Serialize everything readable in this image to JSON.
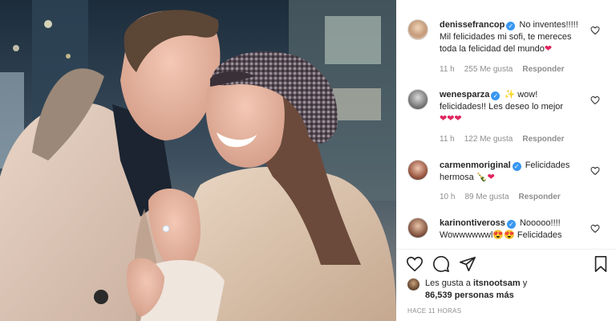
{
  "post": {
    "photo_alt": "",
    "comments": [
      {
        "username": "denissefrancop",
        "verified": true,
        "text_line1": "No inventes!!!!!",
        "text_line2": "Mil felicidades mi sofi, te mereces",
        "text_line3": "toda la felicidad del mundo",
        "emoji": "❤",
        "time": "11 h",
        "likes": "255 Me gusta",
        "reply": "Responder"
      },
      {
        "username": "wenesparza",
        "verified": true,
        "text_line1": "wow!",
        "text_line2": "felicidades!! Les deseo lo mejor",
        "emoji": "❤❤❤",
        "time": "11 h",
        "likes": "122 Me gusta",
        "reply": "Responder"
      },
      {
        "username": "carmenmoriginal",
        "verified": true,
        "text_line1": "Felicidades",
        "text_line2": "hermosa",
        "emoji": "❤",
        "time": "10 h",
        "likes": "89 Me gusta",
        "reply": "Responder"
      },
      {
        "username": "karinontiveross",
        "verified": true,
        "text_line1": "Nooooo!!!!",
        "text_line2": "Wowwwwwwl",
        "text_line2b": "Felicidades",
        "emoji": "😍😍"
      }
    ],
    "likes_summary": {
      "prefix": "Les gusta a",
      "liker": "itsnootsam",
      "suffix": "y",
      "count": "86,539 personas más"
    },
    "timestamp": "HACE 11 HORAS"
  },
  "icons": {
    "like": "heart-outline-icon",
    "comment": "comment-bubble-icon",
    "share": "paper-plane-icon",
    "save": "bookmark-icon",
    "verified": "verified-badge-icon"
  },
  "colors": {
    "verified_blue": "#3897f0",
    "heart_red": "#e0245e",
    "muted_text": "#8e8e8e"
  }
}
